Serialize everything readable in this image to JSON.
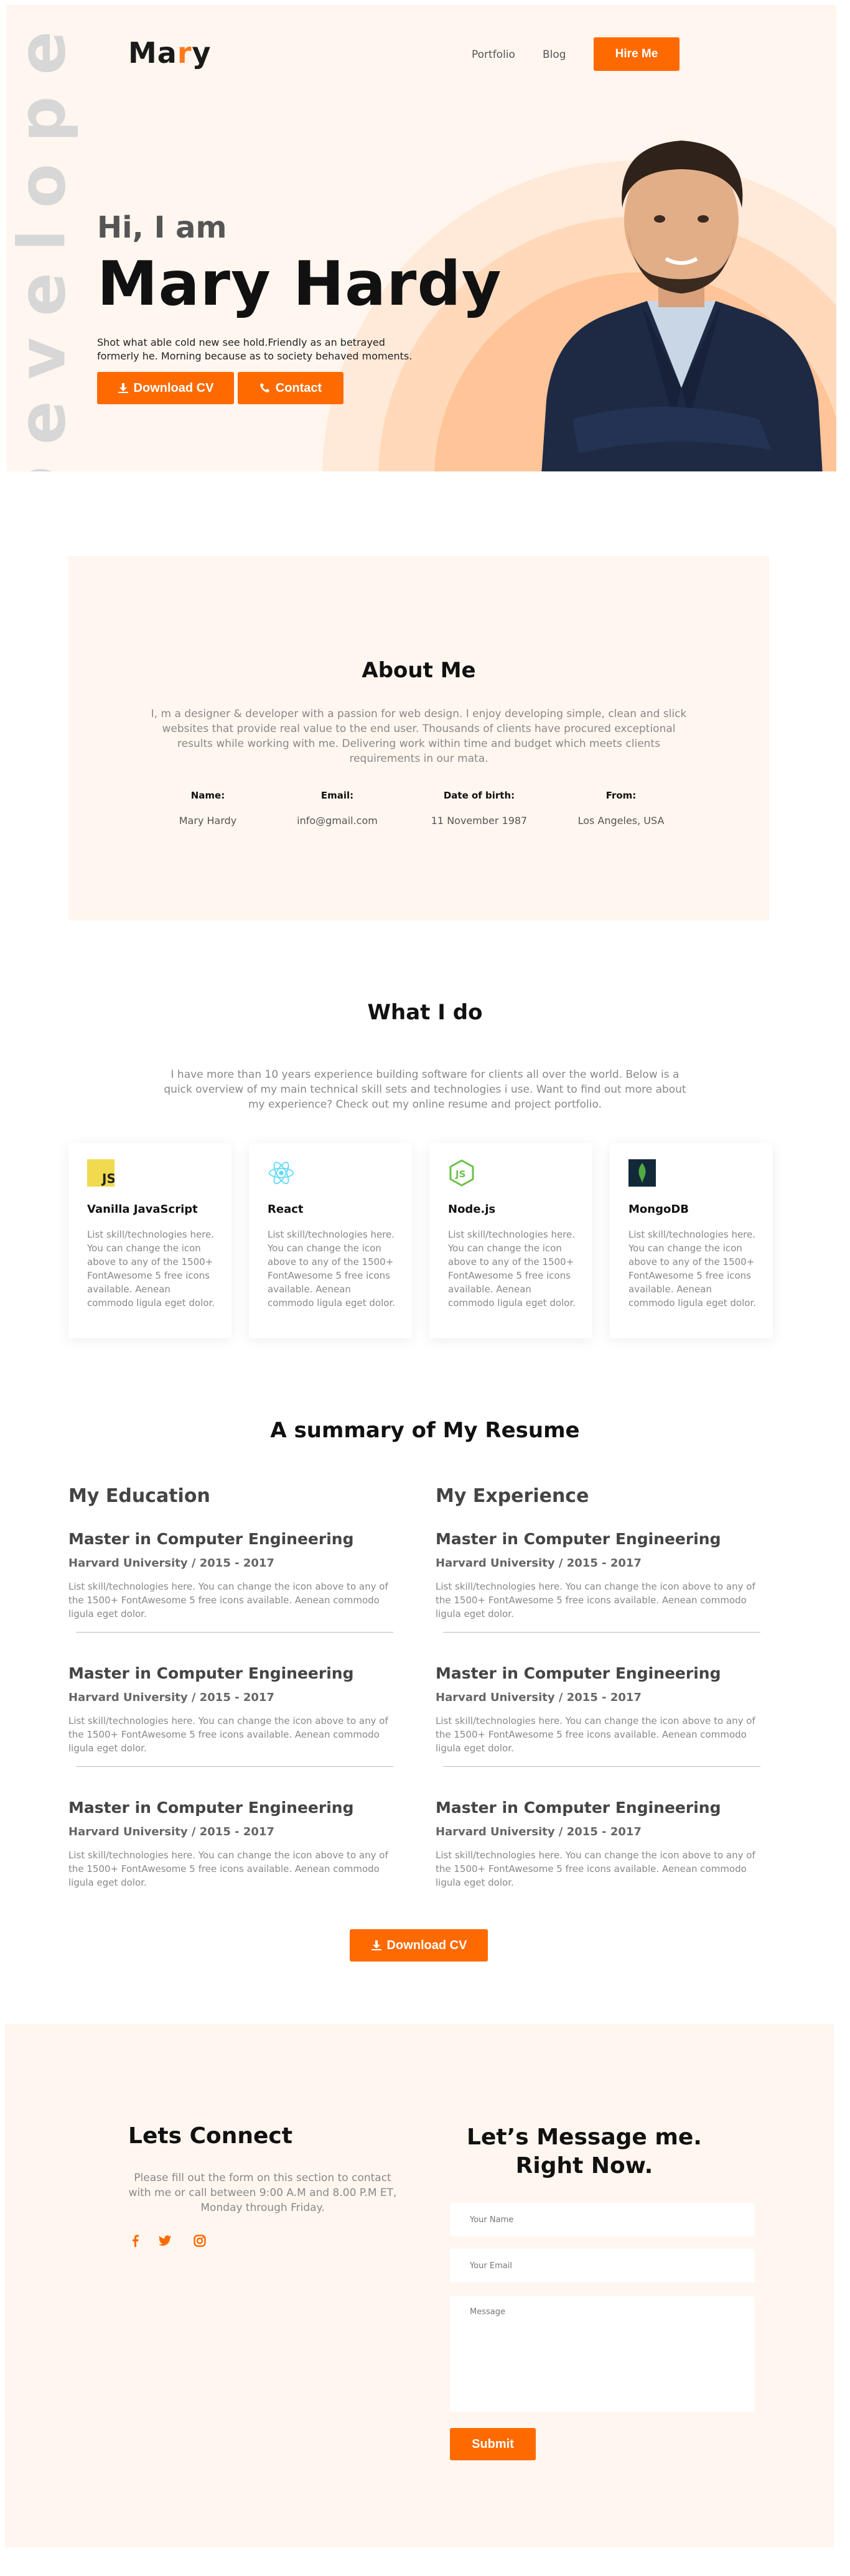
{
  "header": {
    "logo_prefix": "Ma",
    "logo_accent": "r",
    "logo_suffix": "y",
    "nav": [
      "Portfolio",
      "Blog"
    ],
    "hire_label": "Hire Me"
  },
  "hero": {
    "vertical_word": "Developer",
    "greeting": "Hi, I am",
    "name": "Mary Hardy",
    "tagline": "Shot what able cold new see hold.Friendly as an betrayed formerly he. Morning because as to society behaved moments.",
    "download_label": "Download CV",
    "contact_label": "Contact"
  },
  "about": {
    "title": "About Me",
    "description": "I, m a designer & developer with a passion for web design. I enjoy developing simple, clean and slick websites that provide real value to the end user. Thousands of clients have procured exceptional results while working with me. Delivering work within time and budget which meets clients requirements in our mata.",
    "info": [
      {
        "label": "Name:",
        "value": "Mary Hardy"
      },
      {
        "label": "Email:",
        "value": "info@gmail.com"
      },
      {
        "label": "Date of birth:",
        "value": "11 November 1987"
      },
      {
        "label": "From:",
        "value": "Los Angeles, USA"
      }
    ]
  },
  "services": {
    "title": "What I do",
    "description": "I have more than 10 years experience building software for clients all over the world. Below is a quick overview of my main technical skill sets and technologies i use. Want to find out more about my experience? Check out my online resume and project portfolio.",
    "cards": [
      {
        "name": "Vanilla JavaScript",
        "icon": "js-icon",
        "description": "List skill/technologies here. You can change the icon above to any of the 1500+ FontAwesome 5 free icons available. Aenean commodo ligula eget dolor."
      },
      {
        "name": "React",
        "icon": "react-icon",
        "description": "List skill/technologies here. You can change the icon above to any of the 1500+ FontAwesome 5 free icons available. Aenean commodo ligula eget dolor."
      },
      {
        "name": "Node.js",
        "icon": "nodejs-icon",
        "description": "List skill/technologies here. You can change the icon above to any of the 1500+ FontAwesome 5 free icons available. Aenean commodo ligula eget dolor."
      },
      {
        "name": "MongoDB",
        "icon": "mongodb-icon",
        "description": "List skill/technologies here. You can change the icon above to any of the 1500+ FontAwesome 5 free icons available. Aenean commodo ligula eget dolor."
      }
    ]
  },
  "resume": {
    "title": "A summary of My Resume",
    "education_heading": "My Education",
    "experience_heading": "My Experience",
    "education": [
      {
        "title": "Master in Computer Engineering",
        "subtitle": "Harvard University / 2015 - 2017",
        "description": "List skill/technologies here. You can change the icon above to any of the 1500+ FontAwesome 5 free icons available. Aenean commodo ligula eget dolor."
      },
      {
        "title": "Master in Computer Engineering",
        "subtitle": "Harvard University / 2015 - 2017",
        "description": "List skill/technologies here. You can change the icon above to any of the 1500+ FontAwesome 5 free icons available. Aenean commodo ligula eget dolor."
      },
      {
        "title": "Master in Computer Engineering",
        "subtitle": "Harvard University / 2015 - 2017",
        "description": "List skill/technologies here. You can change the icon above to any of the 1500+ FontAwesome 5 free icons available. Aenean commodo ligula eget dolor."
      }
    ],
    "experience": [
      {
        "title": "Master in Computer Engineering",
        "subtitle": "Harvard University / 2015 - 2017",
        "description": "List skill/technologies here. You can change the icon above to any of the 1500+ FontAwesome 5 free icons available. Aenean commodo ligula eget dolor."
      },
      {
        "title": "Master in Computer Engineering",
        "subtitle": "Harvard University / 2015 - 2017",
        "description": "List skill/technologies here. You can change the icon above to any of the 1500+ FontAwesome 5 free icons available. Aenean commodo ligula eget dolor."
      },
      {
        "title": "Master in Computer Engineering",
        "subtitle": "Harvard University / 2015 - 2017",
        "description": "List skill/technologies here. You can change the icon above to any of the 1500+ FontAwesome 5 free icons available. Aenean commodo ligula eget dolor."
      }
    ],
    "download_label": "Download CV"
  },
  "contact": {
    "title": "Lets Connect",
    "description": "Please fill out the form on this section to contact with me or call between 9:00 A.M and 8.00 P.M ET, Monday through Friday.",
    "social_icons": [
      "facebook-icon",
      "twitter-icon",
      "instagram-icon"
    ],
    "form_title": "Let’s Message me. Right Now.",
    "name_placeholder": "Your Name",
    "email_placeholder": "Your Email",
    "message_placeholder": "Message",
    "submit_label": "Submit"
  },
  "colors": {
    "accent": "#ff6a00",
    "hero_bg": "#fff6ef",
    "circle_light": "#ffe9d8",
    "circle_mid": "#ffd9ba",
    "circle_dark": "#ffc497"
  }
}
